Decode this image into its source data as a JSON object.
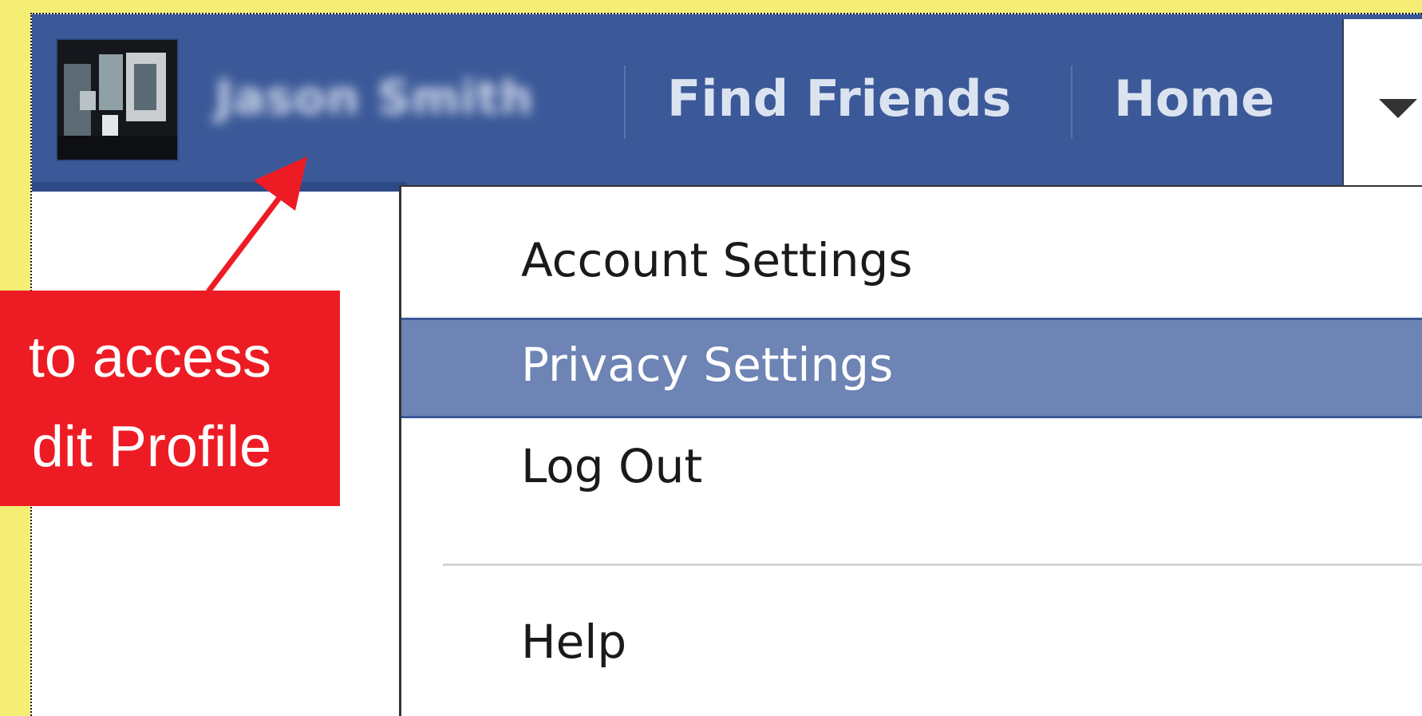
{
  "topbar": {
    "profile_name": "Jason Smith",
    "nav": [
      "Find Friends",
      "Home"
    ],
    "account_menu_icon": "caret-down"
  },
  "account_menu": {
    "items": [
      {
        "label": "Account Settings",
        "state": "normal"
      },
      {
        "label": "Privacy Settings",
        "state": "hover"
      },
      {
        "label": "Log Out",
        "state": "normal"
      },
      {
        "label": "Help",
        "state": "normal"
      }
    ]
  },
  "annotation": {
    "lines": [
      "to access",
      "dit Profile"
    ],
    "color": "#ED1C24"
  },
  "colors": {
    "topbar": "#3B5998",
    "menu_hover": "#6D84B4",
    "frame": "#F4EE74"
  }
}
